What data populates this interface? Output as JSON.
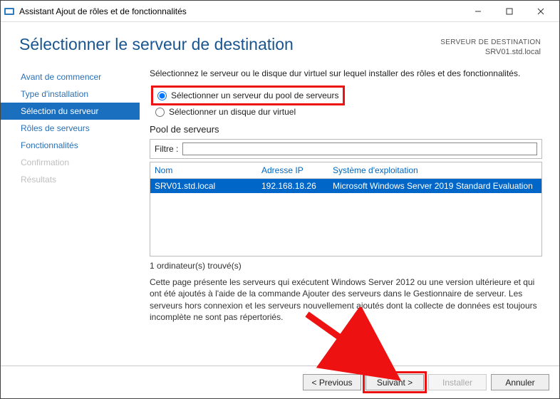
{
  "window": {
    "title": "Assistant Ajout de rôles et de fonctionnalités"
  },
  "header": {
    "title": "Sélectionner le serveur de destination",
    "dest_label": "SERVEUR DE DESTINATION",
    "dest_value": "SRV01.std.local"
  },
  "sidebar": {
    "items": [
      {
        "label": "Avant de commencer"
      },
      {
        "label": "Type d'installation"
      },
      {
        "label": "Sélection du serveur"
      },
      {
        "label": "Rôles de serveurs"
      },
      {
        "label": "Fonctionnalités"
      },
      {
        "label": "Confirmation"
      },
      {
        "label": "Résultats"
      }
    ]
  },
  "main": {
    "intro": "Sélectionnez le serveur ou le disque dur virtuel sur lequel installer des rôles et des fonctionnalités.",
    "radio_pool": "Sélectionner un serveur du pool de serveurs",
    "radio_vhd": "Sélectionner un disque dur virtuel",
    "pool_title": "Pool de serveurs",
    "filter_label": "Filtre :",
    "filter_value": "",
    "columns": {
      "name": "Nom",
      "ip": "Adresse IP",
      "os": "Système d'exploitation"
    },
    "rows": [
      {
        "name": "SRV01.std.local",
        "ip": "192.168.18.26",
        "os": "Microsoft Windows Server 2019 Standard Evaluation"
      }
    ],
    "count": "1 ordinateur(s) trouvé(s)",
    "explain": "Cette page présente les serveurs qui exécutent Windows Server 2012 ou une version ultérieure et qui ont été ajoutés à l'aide de la commande Ajouter des serveurs dans le Gestionnaire de serveur. Les serveurs hors connexion et les serveurs nouvellement ajoutés dont la collecte de données est toujours incomplète ne sont pas répertoriés."
  },
  "footer": {
    "previous": "< Previous",
    "next": "Suivant >",
    "install": "Installer",
    "cancel": "Annuler"
  }
}
